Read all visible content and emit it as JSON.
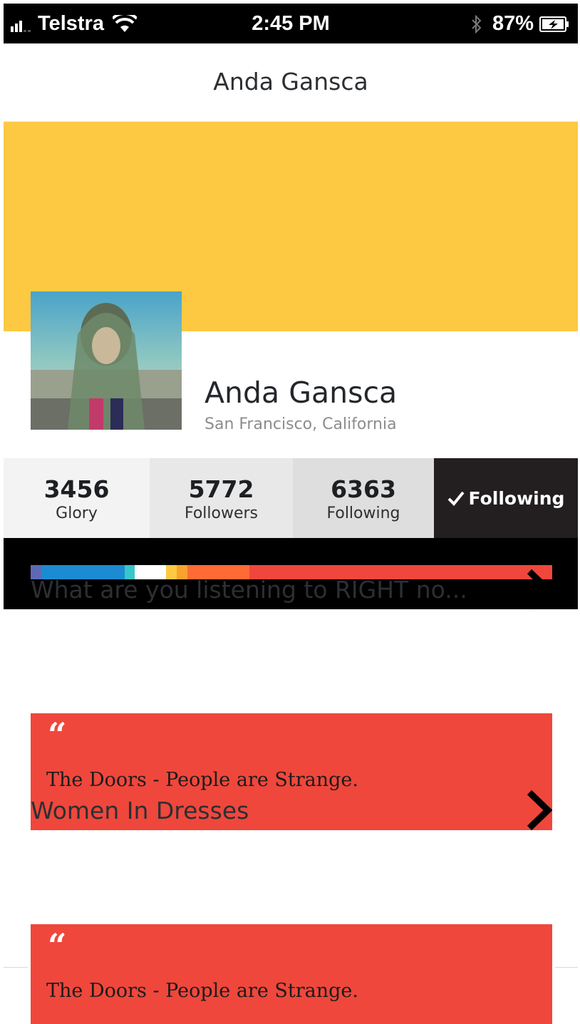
{
  "status_bar": {
    "carrier": "Telstra",
    "time": "2:45 PM",
    "battery": "87%"
  },
  "nav": {
    "title": "Anda Gansca"
  },
  "profile": {
    "name": "Anda Gansca",
    "location": "San Francisco, California",
    "cover_color": "#fdc943"
  },
  "stats": [
    {
      "value": "3456",
      "label": "Glory"
    },
    {
      "value": "5772",
      "label": "Followers"
    },
    {
      "value": "6363",
      "label": "Following"
    }
  ],
  "follow_button": {
    "label": "Following",
    "icon": "checkmark-icon"
  },
  "color_band": {
    "segments": [
      {
        "color": "#5d69b5",
        "fraction": 0.02
      },
      {
        "color": "#1d8bd1",
        "fraction": 0.16
      },
      {
        "color": "#37c6c9",
        "fraction": 0.02
      },
      {
        "color": "#ffffff",
        "fraction": 0.06
      },
      {
        "color": "#fdc943",
        "fraction": 0.02
      },
      {
        "color": "#f7a32e",
        "fraction": 0.02
      },
      {
        "color": "#ff6b35",
        "fraction": 0.12
      },
      {
        "color": "#ef473c",
        "fraction": 0.58
      }
    ]
  },
  "feed": [
    {
      "question": "What are you listening to RIGHT no...",
      "answer": "The Doors - People are Strange."
    },
    {
      "question": "Women In Dresses",
      "answer": "The Doors - People are Strange."
    }
  ],
  "quote_mark": "“",
  "colors": {
    "accent_red": "#ef473c",
    "follow_bg": "#231f20"
  }
}
